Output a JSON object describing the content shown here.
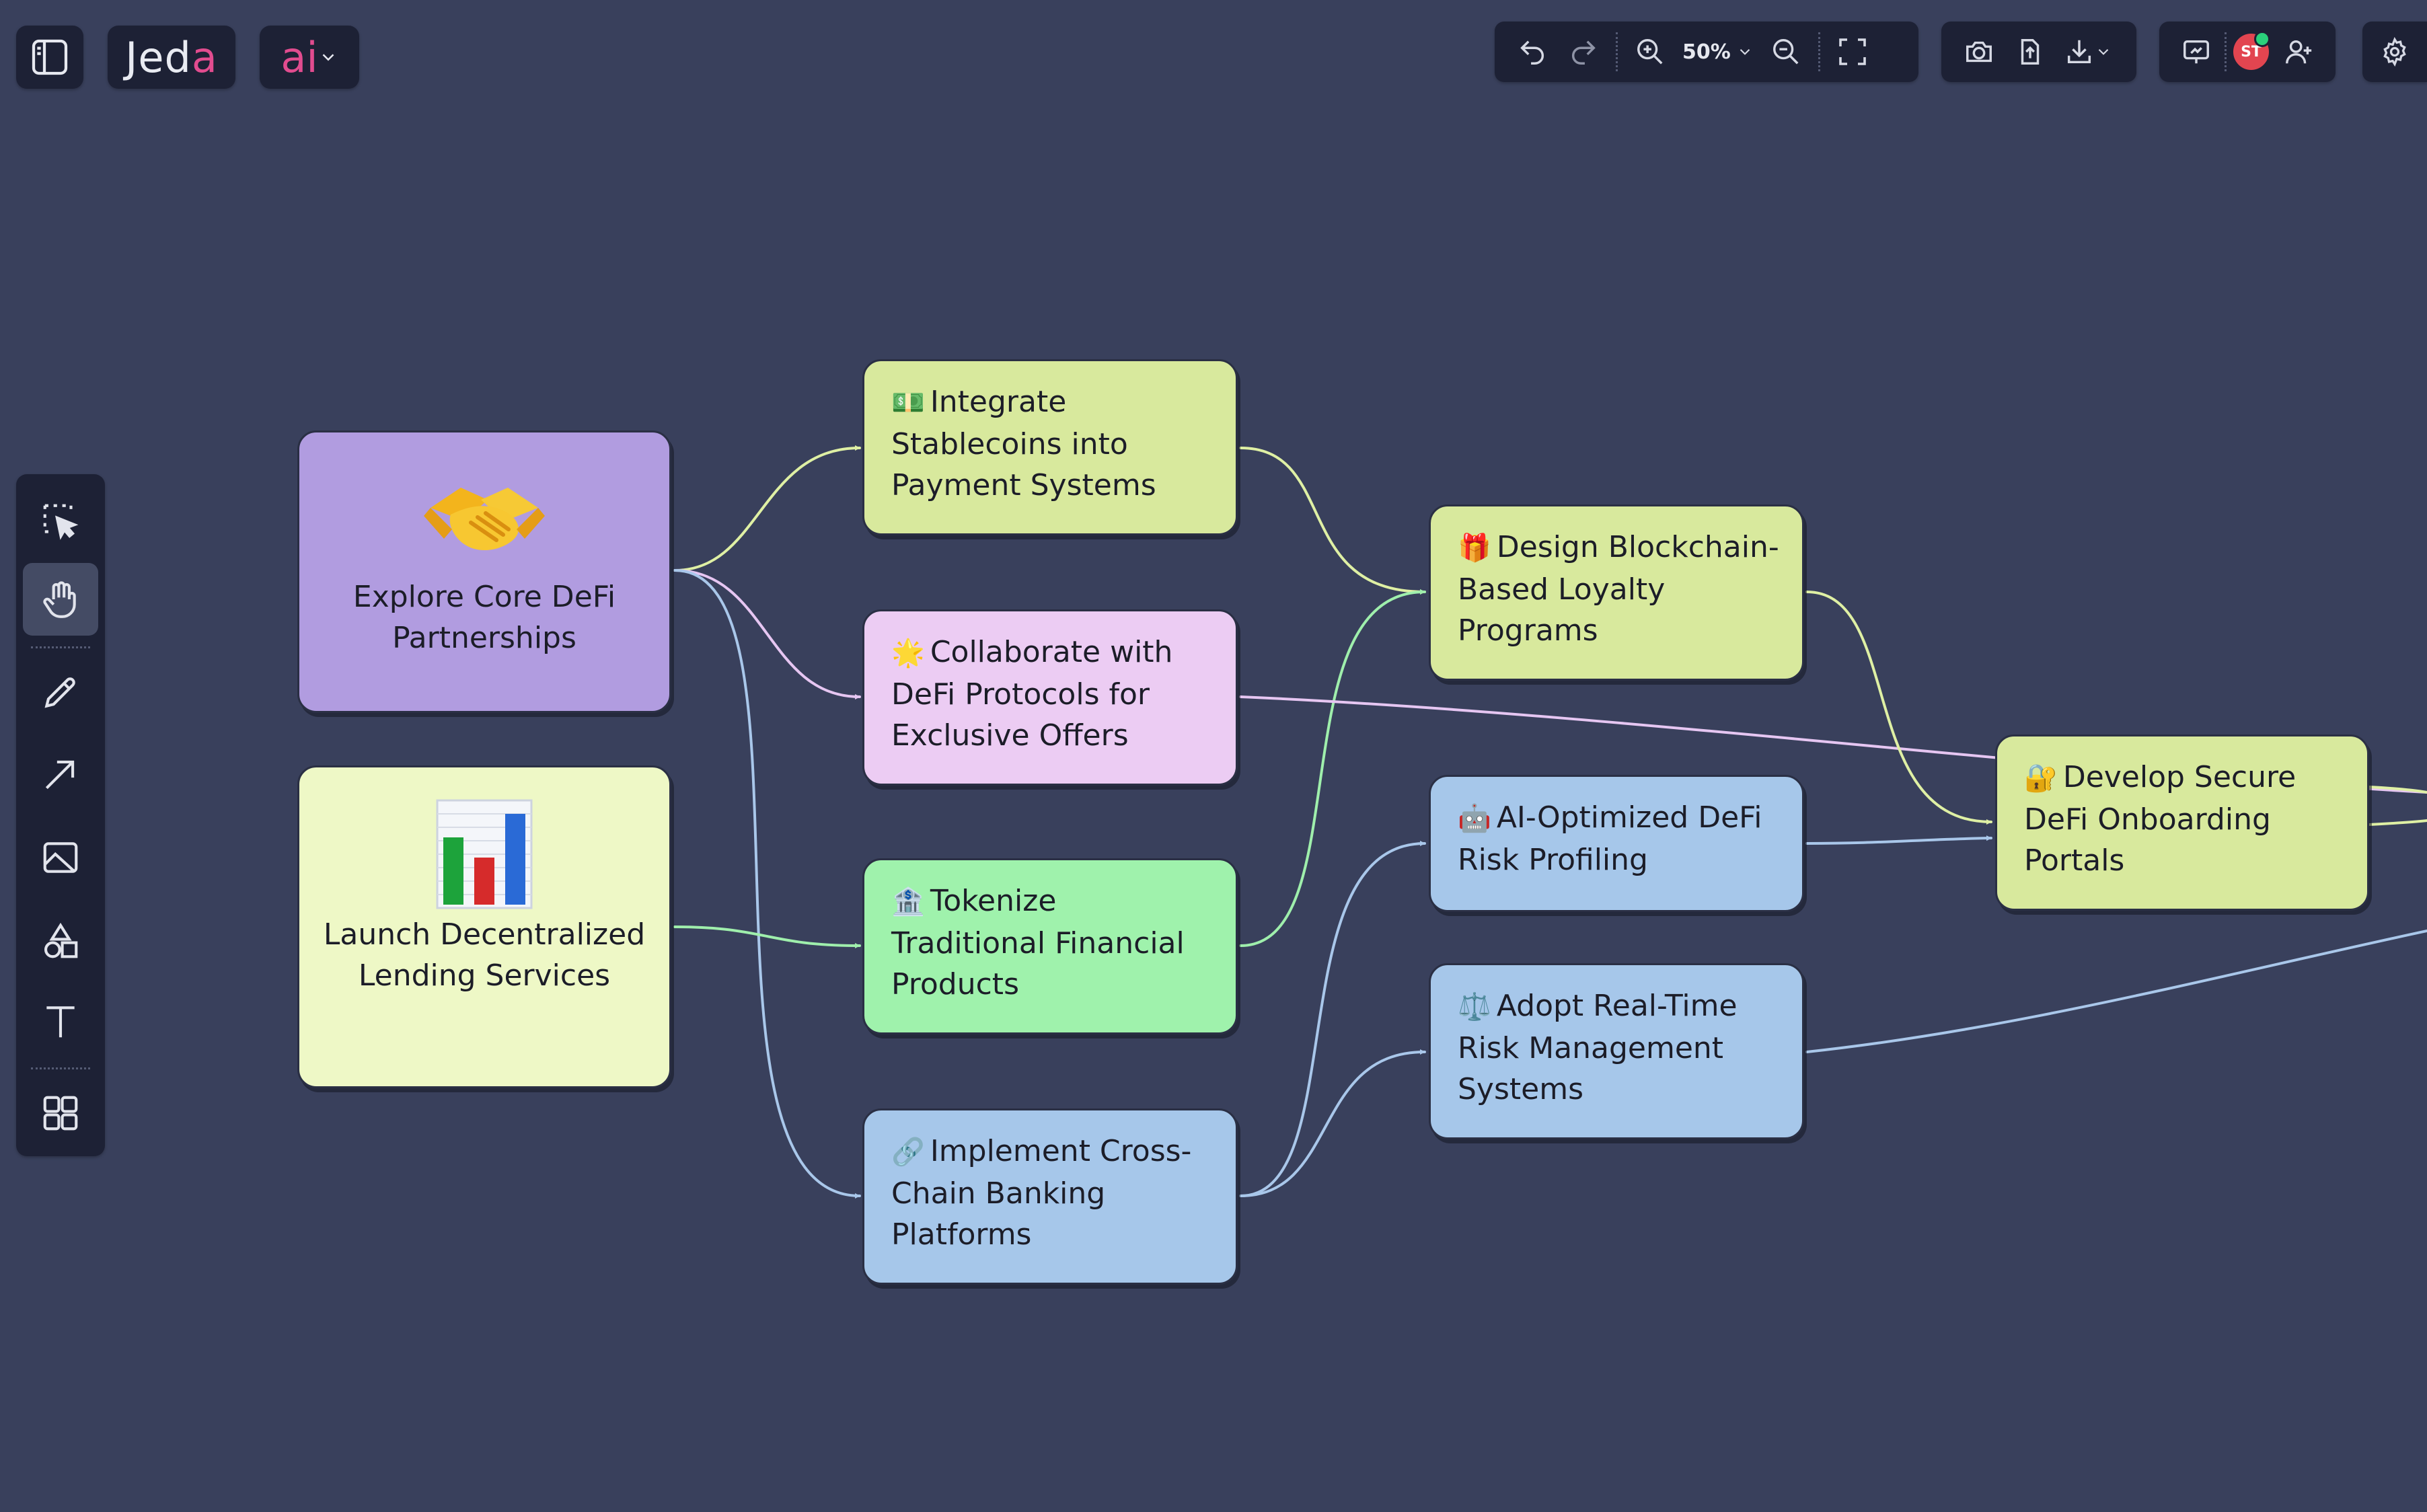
{
  "app": {
    "logo": {
      "prefix": "Jed",
      "accent": "a"
    },
    "ai_label": "ai"
  },
  "toolbar": {
    "zoom": "50%",
    "avatar_initials": "ST"
  },
  "colors": {
    "background": "#39405c",
    "panel": "#1d2135",
    "accent": "#e24c8f",
    "node_purple": "#b19ce0",
    "node_lime": "#eef8c6",
    "node_yellowgreen": "#d8e99d",
    "node_pink": "#ecccf3",
    "node_green": "#9ff2ac",
    "node_blue": "#a6c7ea",
    "edge_lime": "#dff0a4",
    "edge_pink": "#e6c6f2",
    "edge_green": "#9fefac",
    "edge_blue": "#a9c7ea"
  },
  "nodes": {
    "explore": {
      "label": "Explore Core DeFi Partnerships",
      "icon": "handshake-icon"
    },
    "lending": {
      "label": "Launch Decentralized Lending Services",
      "icon": "bar-chart-icon"
    },
    "stablecoins": {
      "label": "Integrate Stablecoins into Payment Systems",
      "icon": "banknote-icon"
    },
    "collaborate": {
      "label": "Collaborate with DeFi Protocols for Exclusive Offers",
      "icon": "star-icon"
    },
    "tokenize": {
      "label": "Tokenize Traditional Financial Products",
      "icon": "bank-icon"
    },
    "crosschain": {
      "label": "Implement Cross-Chain Banking Platforms",
      "icon": "link-icon"
    },
    "loyalty": {
      "label": "Design Blockchain-Based Loyalty Programs",
      "icon": "gift-icon"
    },
    "ai_risk": {
      "label": "AI-Optimized DeFi Risk Profiling",
      "icon": "robot-icon"
    },
    "realtime": {
      "label": "Adopt Real-Time Risk Management Systems",
      "icon": "scales-icon"
    },
    "onboarding": {
      "label": "Develop Secure DeFi Onboarding Portals",
      "icon": "lock-key-icon"
    }
  }
}
